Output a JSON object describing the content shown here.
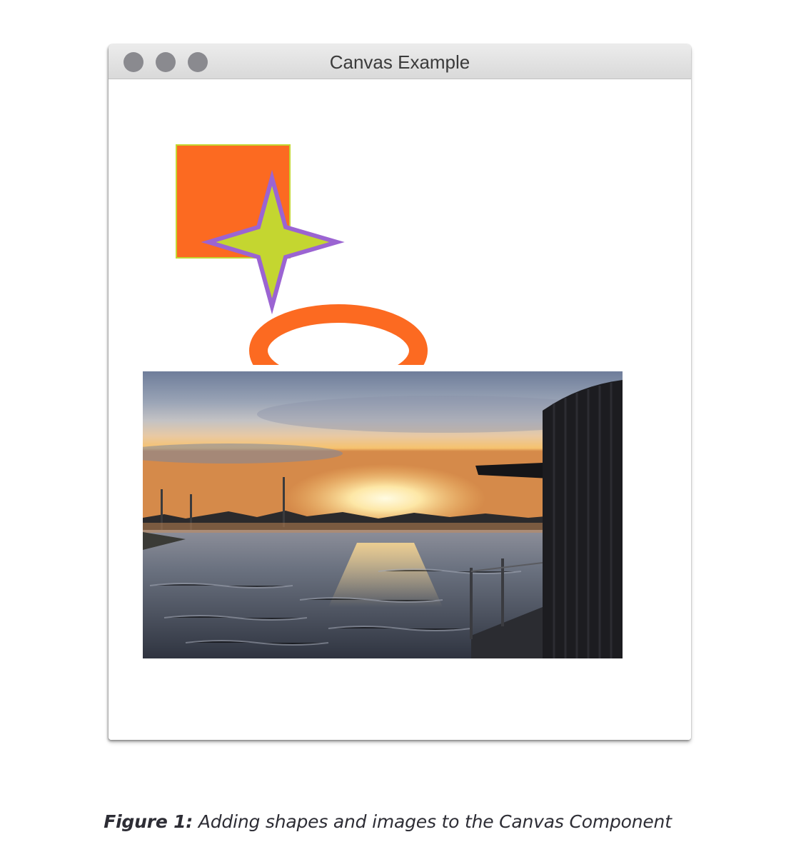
{
  "window": {
    "title": "Canvas Example"
  },
  "caption": {
    "label": "Figure 1:",
    "text": "Adding shapes and images to the Canvas Component"
  },
  "colors": {
    "shape_orange": "#fc6a21",
    "star_fill": "#c4d630",
    "star_stroke": "#9b64d2",
    "square_border": "#c4d630",
    "traffic_light": "#8a8a8f"
  },
  "icons": {
    "close": "close-dot-icon",
    "minimize": "minimize-dot-icon",
    "maximize": "maximize-dot-icon"
  }
}
